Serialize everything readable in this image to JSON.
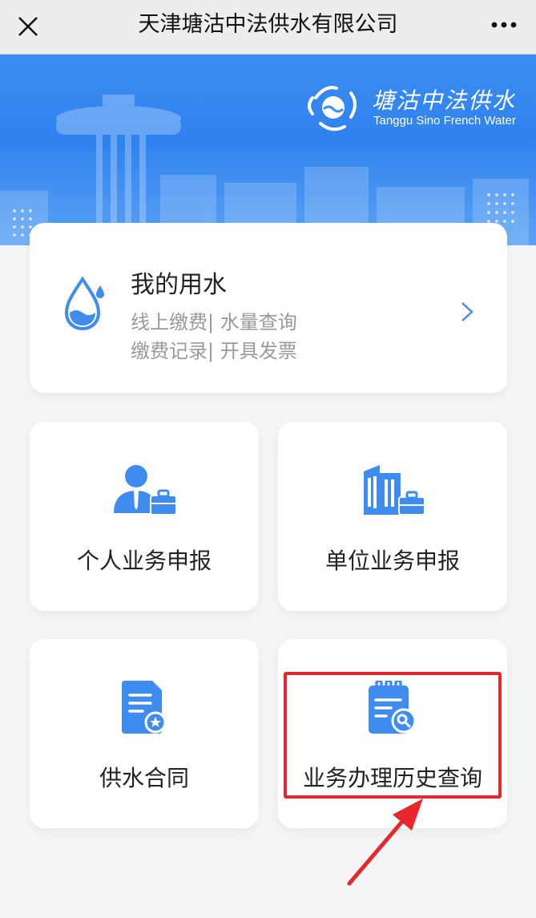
{
  "topbar": {
    "title": "天津塘沽中法供水有限公司"
  },
  "banner": {
    "brand_cn": "塘沽中法供水",
    "brand_en": "Tanggu Sino French Water"
  },
  "water_card": {
    "title": "我的用水",
    "line1": "线上缴费| 水量查询",
    "line2": "缴费记录| 开具发票"
  },
  "tiles": [
    {
      "label": "个人业务申报",
      "icon": "person-briefcase-icon"
    },
    {
      "label": "单位业务申报",
      "icon": "building-briefcase-icon"
    },
    {
      "label": "供水合同",
      "icon": "contract-document-icon"
    },
    {
      "label": "业务办理历史查询",
      "icon": "history-search-icon"
    }
  ],
  "colors": {
    "accent": "#3f8cf0",
    "highlight": "#e8262d"
  }
}
